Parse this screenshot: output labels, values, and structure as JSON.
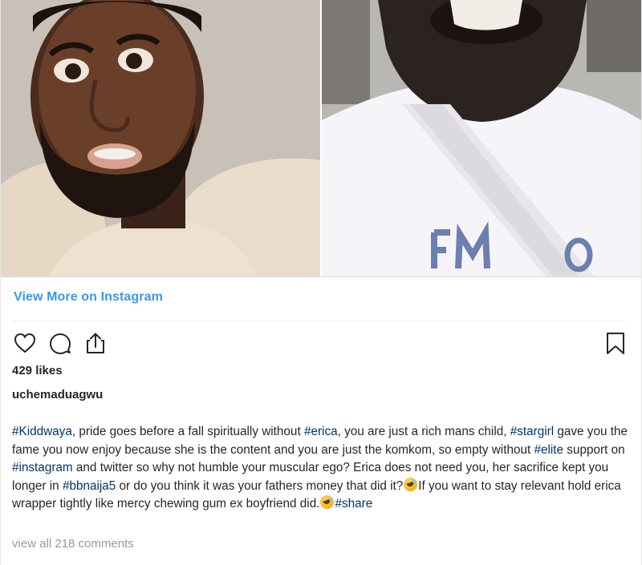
{
  "post": {
    "view_more_label": "View More on Instagram",
    "likes_text": "429 likes",
    "username": "uchemaduagwu",
    "caption": {
      "segments": [
        {
          "tag": "#Kiddwaya"
        },
        {
          "text": ", pride goes before a fall spiritually without "
        },
        {
          "tag": "#erica"
        },
        {
          "text": ", you are just a rich mans child, "
        },
        {
          "tag": "#stargirl"
        },
        {
          "text": " gave you the fame you now enjoy because she is the content and you are just the komkom, so empty without "
        },
        {
          "tag": "#elite"
        },
        {
          "text": " support on "
        },
        {
          "tag": "#instagram"
        },
        {
          "text": " and twitter so why not humble your muscular ego? Erica does not need you, her sacrifice kept you longer in "
        },
        {
          "tag": "#bbnaija5"
        },
        {
          "text": " or do you think it was your fathers money that did it?"
        },
        {
          "emoji": "rolling-on-floor-laughing"
        },
        {
          "text": "If you want to stay relevant hold erica wrapper tightly like mercy chewing gum ex boyfriend did."
        },
        {
          "emoji": "rolling-on-floor-laughing"
        },
        {
          "tag": "#share"
        }
      ]
    },
    "comments_link": "view all 218 comments"
  },
  "icons": {
    "like": "heart-outline-icon",
    "comment": "comment-bubble-icon",
    "share": "share-upload-icon",
    "save": "bookmark-outline-icon"
  },
  "colors": {
    "link_blue": "#3897f0",
    "hashtag": "#003569",
    "text": "#262626",
    "muted": "#999999"
  }
}
